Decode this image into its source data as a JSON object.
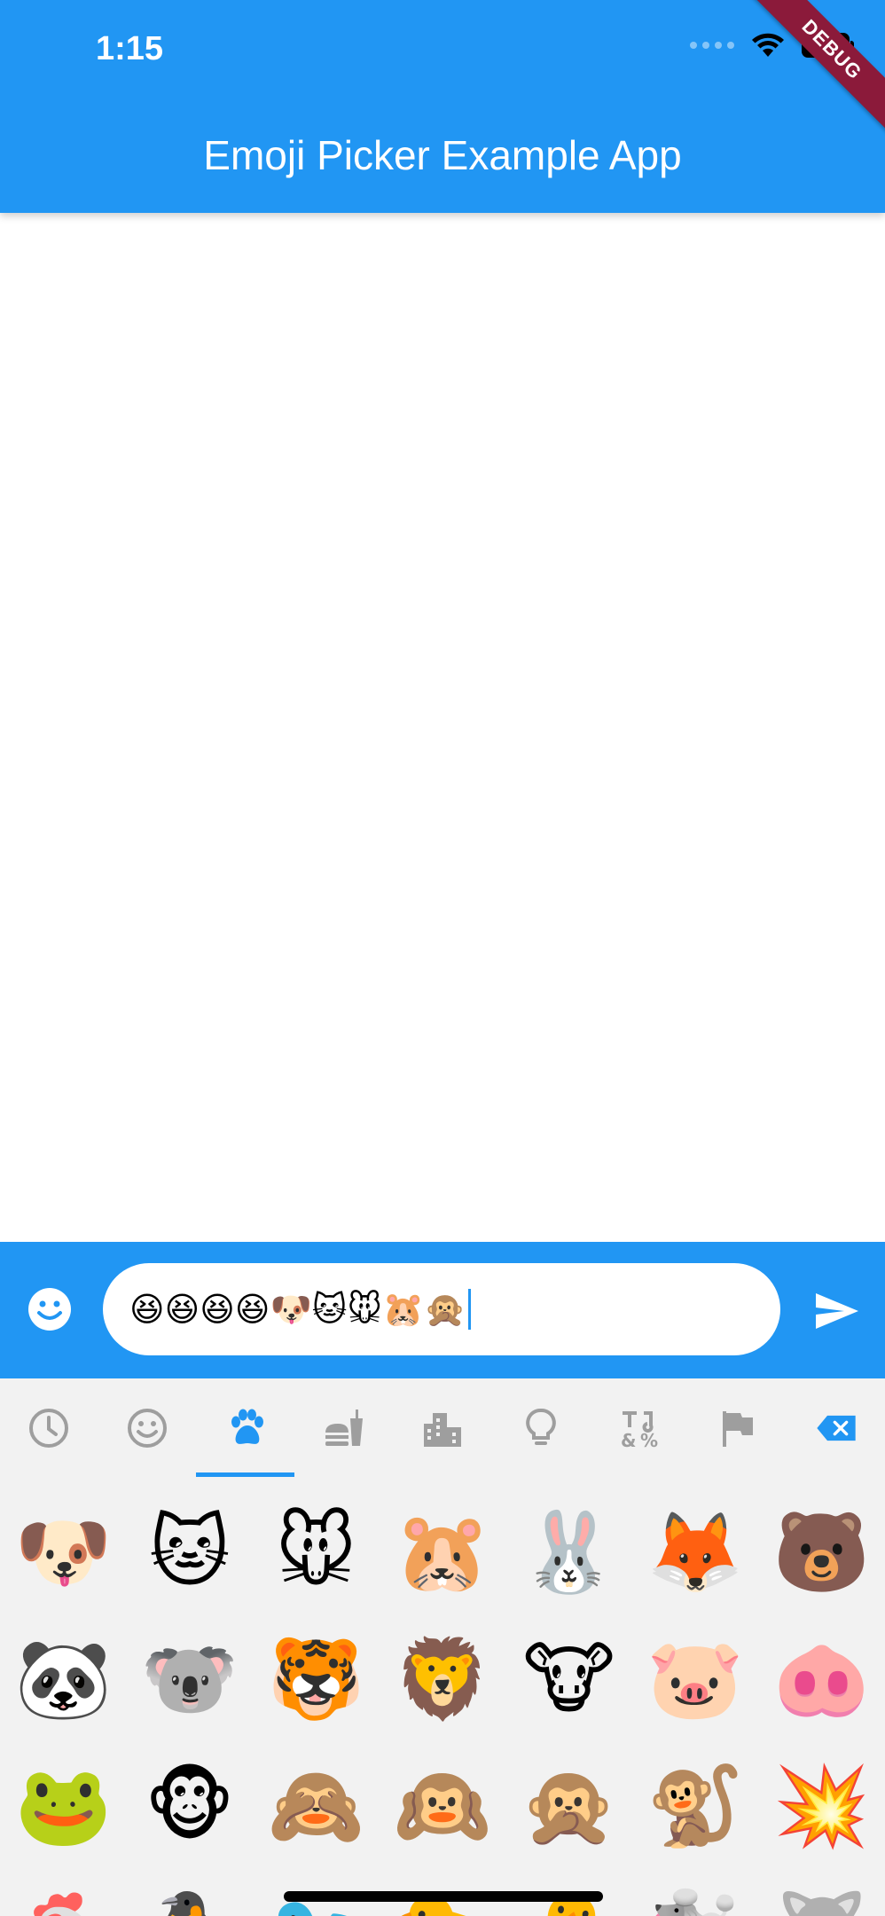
{
  "status_bar": {
    "time": "1:15"
  },
  "app_bar": {
    "title": "Emoji Picker Example App",
    "debug_banner": "DEBUG",
    "background_color": "#2196F3"
  },
  "input": {
    "value": "😆😆😆😆🐶🐱🐭🐹🙊",
    "emoji_toggle_icon": "smiley-face-icon",
    "send_icon": "send-icon"
  },
  "picker": {
    "accent_color": "#2196F3",
    "selected_tab": "animals",
    "tabs": [
      {
        "name": "recent",
        "icon": "clock-icon"
      },
      {
        "name": "smileys",
        "icon": "smiley-icon"
      },
      {
        "name": "animals",
        "icon": "paw-icon"
      },
      {
        "name": "food",
        "icon": "fastfood-icon"
      },
      {
        "name": "travel",
        "icon": "city-icon"
      },
      {
        "name": "objects",
        "icon": "lightbulb-icon"
      },
      {
        "name": "symbols",
        "icon": "symbols-icon"
      },
      {
        "name": "flags",
        "icon": "flag-icon"
      },
      {
        "name": "backspace",
        "icon": "backspace-icon"
      }
    ],
    "emojis": [
      "🐶",
      "🐱",
      "🐭",
      "🐹",
      "🐰",
      "🦊",
      "🐻",
      "🐼",
      "🐨",
      "🐯",
      "🦁",
      "🐮",
      "🐷",
      "🐽",
      "🐸",
      "🐵",
      "🙈",
      "🙉",
      "🙊",
      "🐒",
      "💥",
      "🐔",
      "🐧",
      "🐦",
      "🐤",
      "🐣",
      "🐩",
      "🐺"
    ]
  }
}
